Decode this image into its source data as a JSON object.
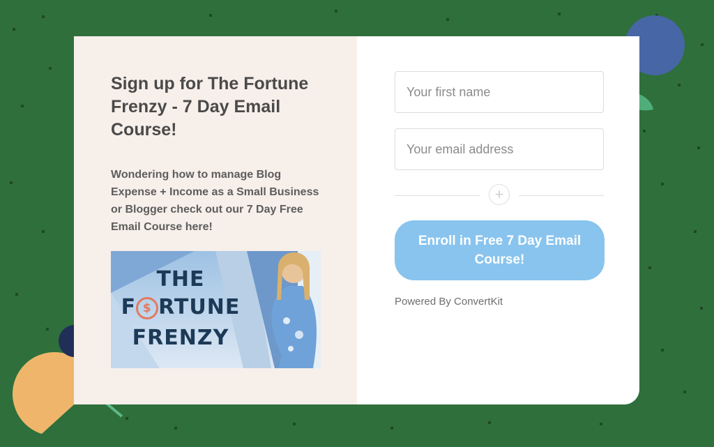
{
  "form": {
    "headline": "Sign up for The Fortune Frenzy - 7 Day Email Course!",
    "description": "Wondering how to manage Blog Expense + Income as a Small Business or Blogger check out our 7 Day Free Email Course here!",
    "promo_image": {
      "line1": "THE",
      "line2_pre": "F",
      "line2_coin": "$",
      "line2_post": "RTUNE",
      "line3": "FRENZY"
    },
    "first_name": {
      "placeholder": "Your first name",
      "value": ""
    },
    "email": {
      "placeholder": "Your email address",
      "value": ""
    },
    "divider_icon": "plus-icon",
    "submit_label": "Enroll in Free 7 Day Email Course!",
    "powered_by": "Powered By ConvertKit"
  },
  "colors": {
    "page_background": "#2f6f3c",
    "left_pane": "#f7efea",
    "button": "#88c4ee",
    "heading_text": "#4a4a4a",
    "promo_text": "#1c3a57",
    "coin_accent": "#e07a5f"
  },
  "decorations": [
    "blue-circle",
    "green-leaf",
    "navy-circle",
    "orange-half-circle",
    "green-bar"
  ]
}
